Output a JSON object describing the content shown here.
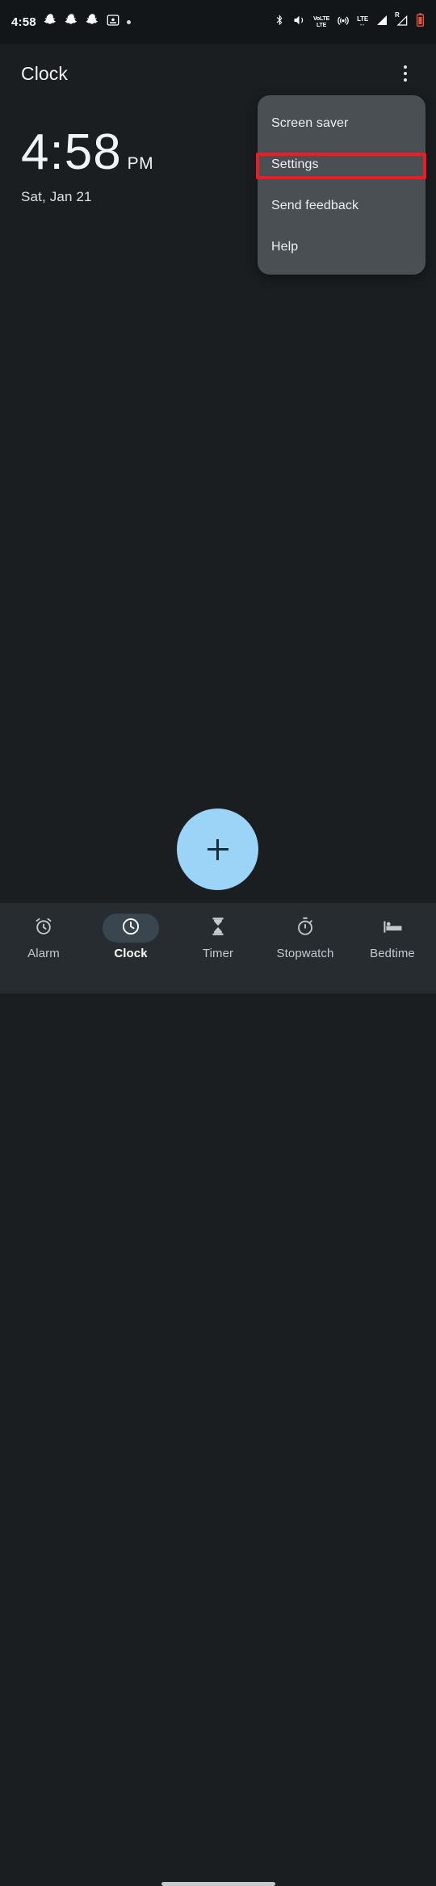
{
  "status_bar": {
    "clock": "4:58",
    "left_icons": [
      {
        "name": "snapchat-icon",
        "label": "Snapchat"
      },
      {
        "name": "snapchat-icon",
        "label": "Snapchat"
      },
      {
        "name": "snapchat-icon",
        "label": "Snapchat"
      },
      {
        "name": "screenshot-icon",
        "label": "Screenshot"
      },
      {
        "name": "notification-dot-icon",
        "label": "More notifications"
      }
    ],
    "right_icons": [
      {
        "name": "bluetooth-icon",
        "label": "Bluetooth"
      },
      {
        "name": "vibrate-icon",
        "label": "Ringer vibrate"
      },
      {
        "name": "volte-icon",
        "label": "VoLTE"
      },
      {
        "name": "hotspot-icon",
        "label": "Hotspot"
      },
      {
        "name": "lte-plus-icon",
        "label": "LTE+"
      },
      {
        "name": "signal-bars-icon",
        "label": "Signal strength"
      },
      {
        "name": "roaming-signal-icon",
        "label": "Roaming signal"
      },
      {
        "name": "battery-low-icon",
        "label": "Battery low"
      }
    ],
    "volte_top": "VoLTE",
    "volte_bottom": "LTE",
    "lte_label": "LTE",
    "roaming_label": "R"
  },
  "app_bar": {
    "title": "Clock",
    "overflow_label": "More options"
  },
  "clock": {
    "time": "4:58",
    "ampm": "PM",
    "date": "Sat, Jan 21"
  },
  "overflow_menu": {
    "items": [
      {
        "label": "Screen saver",
        "highlighted": false
      },
      {
        "label": "Settings",
        "highlighted": true
      },
      {
        "label": "Send feedback",
        "highlighted": false
      },
      {
        "label": "Help",
        "highlighted": false
      }
    ]
  },
  "fab": {
    "label": "Add city"
  },
  "bottom_nav": {
    "items": [
      {
        "label": "Alarm",
        "icon": "alarm-icon",
        "active": false
      },
      {
        "label": "Clock",
        "icon": "clock-icon",
        "active": true
      },
      {
        "label": "Timer",
        "icon": "hourglass-icon",
        "active": false
      },
      {
        "label": "Stopwatch",
        "icon": "stopwatch-icon",
        "active": false
      },
      {
        "label": "Bedtime",
        "icon": "bed-icon",
        "active": false
      }
    ]
  },
  "colors": {
    "background": "#1b1e21",
    "status_bar": "#131619",
    "nav_bar": "#272c31",
    "menu_surface": "#4a4f54",
    "fab": "#9cd4f7",
    "active_pill": "#39454f",
    "highlight": "#ed1c24",
    "text_primary": "#f1f3f4",
    "text_secondary": "#c4c9ce"
  }
}
